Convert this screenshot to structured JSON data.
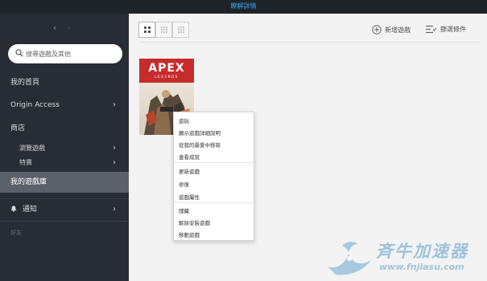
{
  "banner": {
    "link": "瞭解詳情"
  },
  "sidebar": {
    "back_arrow": "‹",
    "forward_arrow": "›",
    "search_placeholder": "搜尋遊戲及其他",
    "items": [
      {
        "label": "我的首頁"
      },
      {
        "label": "Origin Access",
        "chevron": "›"
      },
      {
        "label": "商店"
      },
      {
        "label": "瀏覽遊戲",
        "chevron": "›"
      },
      {
        "label": "特賣",
        "chevron": "›"
      },
      {
        "label": "我的遊戲庫"
      },
      {
        "label": "通知",
        "chevron": "›"
      }
    ],
    "friends_label": "好友"
  },
  "main": {
    "add_game": "新增遊戲",
    "filter": "篩選條件",
    "game": {
      "title": "APEX",
      "subtitle": "LEGENDS"
    },
    "context_menu": [
      "遊玩",
      "顯示遊戲詳細說明",
      "從我的最愛中移除",
      "查看成就",
      "更新遊戲",
      "修復",
      "遊戲屬性",
      "隱藏",
      "解除安裝遊戲",
      "移動遊戲"
    ]
  },
  "watermark": {
    "title": "斉牛加速器",
    "url": "www.fnjiasu.com"
  },
  "colors": {
    "sidebar_bg": "#282d33",
    "active_item_bg": "#5b6168",
    "banner_link": "#3aa0e6",
    "apex_red": "#c72c2c"
  }
}
